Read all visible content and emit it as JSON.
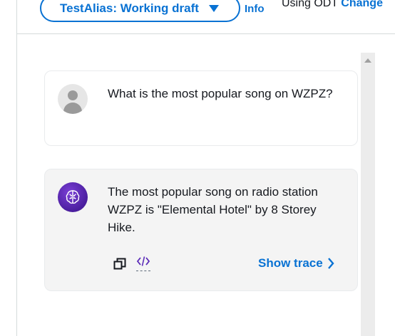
{
  "header": {
    "alias_label": "TestAlias: Working draft",
    "info_label": "Info",
    "using_prefix": "Using ODT",
    "change_label": "Change"
  },
  "messages": [
    {
      "role": "user",
      "avatar_icon": "user-avatar-icon",
      "text": "What is the most popular song on WZPZ?"
    },
    {
      "role": "assistant",
      "avatar_icon": "brain-ai-icon",
      "text": "The most popular song on radio station WZPZ is \"Elemental Hotel\" by 8 Storey Hike.",
      "actions": {
        "copy_icon": "copy-icon",
        "code_icon": "code-icon",
        "show_trace_label": "Show trace"
      }
    }
  ],
  "colors": {
    "accent": "#0972d3",
    "bot_card_bg": "#f4f4f4",
    "bot_avatar": "#5b2bb8",
    "border": "#d5dbdb"
  }
}
